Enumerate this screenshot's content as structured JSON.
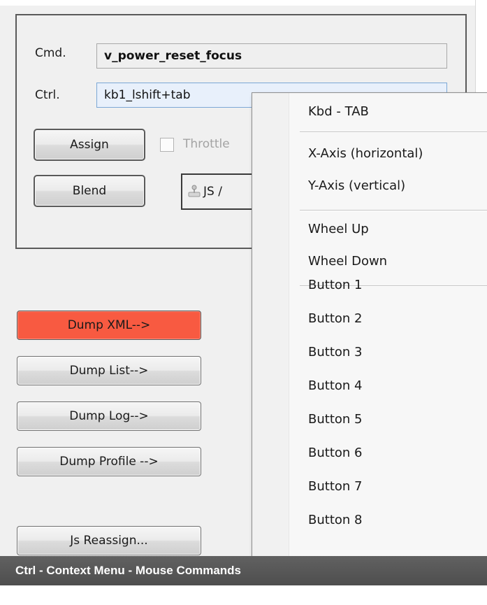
{
  "form": {
    "cmd_label": "Cmd.",
    "cmd_value": "v_power_reset_focus",
    "ctrl_label": "Ctrl.",
    "ctrl_value": "kb1_lshift+tab",
    "assign_label": "Assign",
    "blend_label": "Blend",
    "throttle_label": "Throttle",
    "js_label": "JS /"
  },
  "actions": {
    "dump_xml": "Dump XML-->",
    "dump_list": "Dump List-->",
    "dump_log": "Dump Log-->",
    "dump_profile": "Dump Profile -->",
    "js_reassign": "Js Reassign..."
  },
  "context_menu": {
    "kbd_tab": "Kbd - TAB",
    "x_axis": "X-Axis (horizontal)",
    "y_axis": "Y-Axis (vertical)",
    "wheel_up": "Wheel Up",
    "wheel_down": "Wheel Down",
    "buttons": [
      "Button 1",
      "Button 2",
      "Button 3",
      "Button 4",
      "Button 5",
      "Button 6",
      "Button 7",
      "Button 8"
    ]
  },
  "caption": "Ctrl - Context Menu - Mouse Commands",
  "colors": {
    "dump_xml_highlight": "#f85a41",
    "caption_bar": "#575757",
    "ctrl_field_focus": "#e8f0fb"
  },
  "icons": {
    "joystick": "joystick-icon"
  }
}
